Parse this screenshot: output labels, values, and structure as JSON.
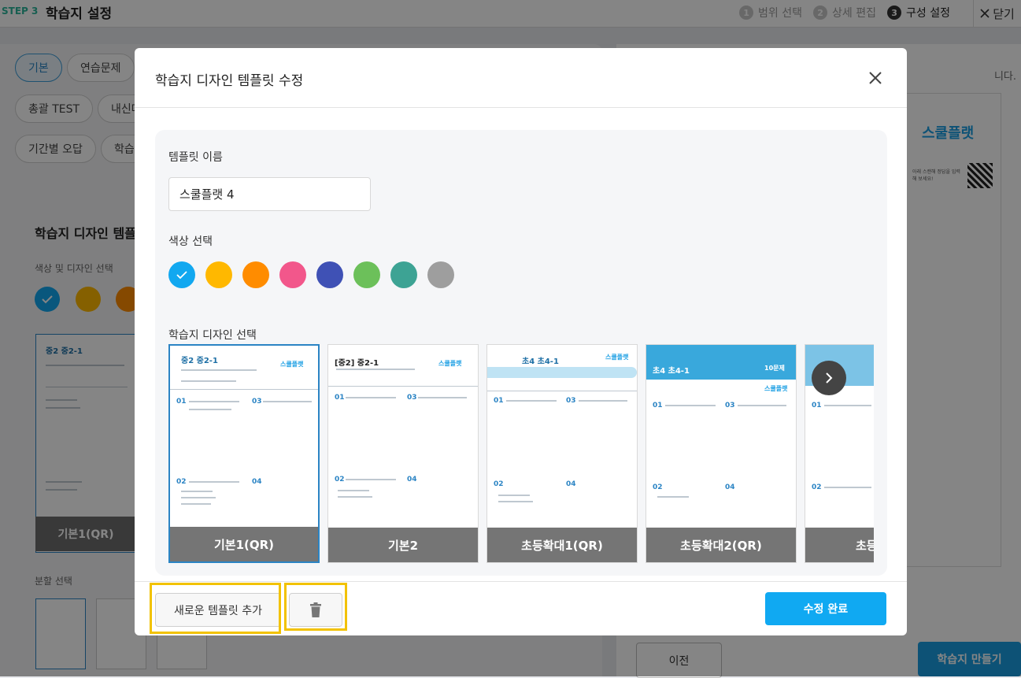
{
  "header": {
    "step_label": "STEP 3",
    "title": "학습지 설정",
    "steps": [
      {
        "num": "1",
        "label": "범위 선택"
      },
      {
        "num": "2",
        "label": "상세 편집"
      },
      {
        "num": "3",
        "label": "구성 설정"
      }
    ],
    "close_label": "닫기"
  },
  "left_panel": {
    "tabs": [
      "기본",
      "연습문제",
      "총괄 TEST",
      "내신대",
      "기간별 오답",
      "학습"
    ],
    "active_tab": "기본",
    "design_title": "학습지 디자인 템플",
    "color_design_label": "색상 및 디자인 선택",
    "selected_thumb_label": "기본1(QR)",
    "split_label": "분할 선택"
  },
  "right_panel": {
    "message_fragment": "니다.",
    "brand": "스쿨플랫",
    "qr_text": "아래 스캔해 정답을 입력해 보세요!",
    "prev_button": "이전",
    "make_button": "학습지 만들기"
  },
  "modal": {
    "title": "학습지 디자인 템플릿 수정",
    "template_name_label": "템플릿 이름",
    "template_name_value": "스쿨플랫 4",
    "color_label": "색상 선택",
    "colors": [
      "#12a8f0",
      "#ffb800",
      "#ff8c00",
      "#f2578b",
      "#3f51b5",
      "#6cc05a",
      "#3da394",
      "#9e9e9e"
    ],
    "selected_color_index": 0,
    "design_label": "학습지 디자인 선택",
    "templates": [
      {
        "label": "기본1(QR)",
        "heading": "중2 중2-1",
        "selected": true
      },
      {
        "label": "기본2",
        "heading": "[중2] 중2-1",
        "selected": false
      },
      {
        "label": "초등확대1(QR)",
        "heading": "초4 초4-1",
        "selected": false
      },
      {
        "label": "초등확대2(QR)",
        "heading": "초4 초4-1",
        "selected": false
      },
      {
        "label": "초등",
        "heading": "",
        "selected": false
      }
    ],
    "mini_brand": "스쿨플랫",
    "mini_badge": "10문제",
    "question_numbers": [
      "01",
      "03",
      "02",
      "04"
    ],
    "add_template_button": "새로운 템플릿 추가",
    "delete_icon": "trash-icon",
    "done_button": "수정 완료"
  }
}
